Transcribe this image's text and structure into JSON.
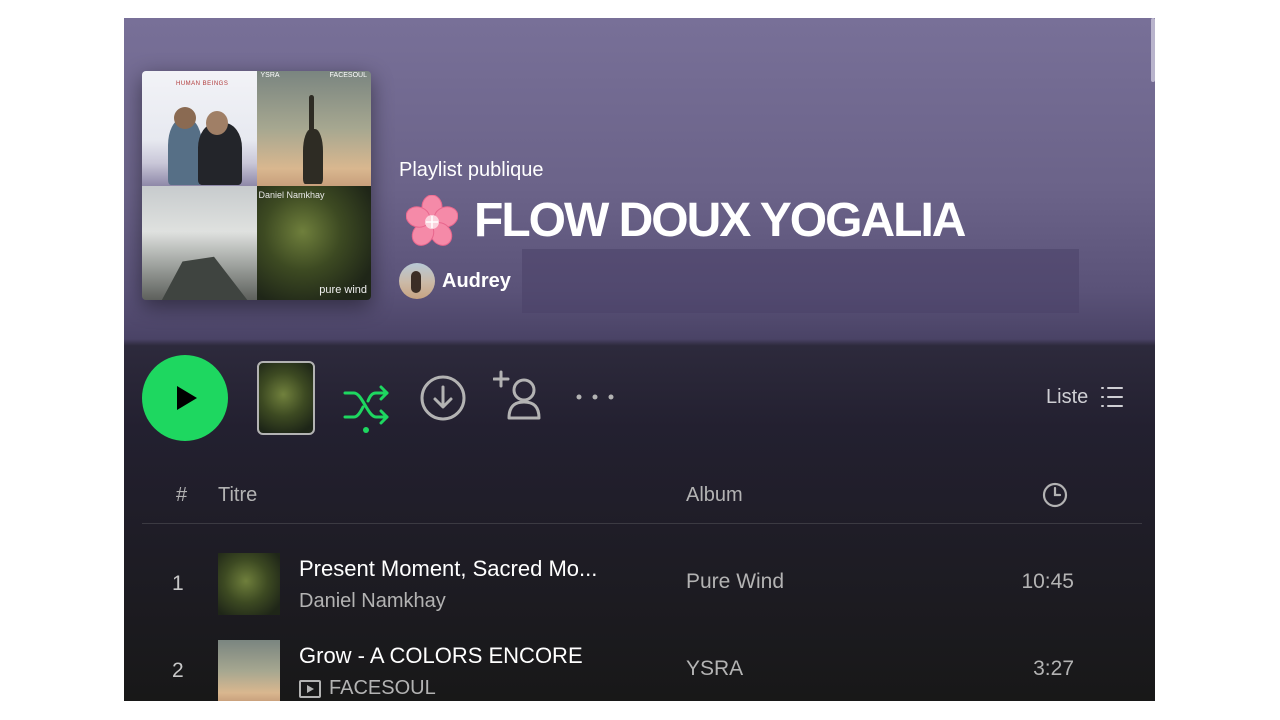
{
  "playlist": {
    "type_label": "Playlist publique",
    "title": "FLOW DOUX YOGALIA",
    "owner": "Audrey",
    "cover_texts": {
      "top_left": "HUMAN BEINGS",
      "top_middle": "YSRA",
      "top_right": "FACESOUL",
      "bottom_right_top": "Daniel Namkhay",
      "bottom_right": "pure wind"
    }
  },
  "actions": {
    "view_label": "Liste",
    "icons": [
      "play-icon",
      "shuffle-icon",
      "download-icon",
      "add-user-icon",
      "more-icon",
      "list-icon"
    ],
    "accent_color": "#1ed760"
  },
  "table": {
    "headers": {
      "number": "#",
      "title": "Titre",
      "album": "Album",
      "duration_icon": "clock-icon"
    },
    "rows": [
      {
        "number": "1",
        "title": "Present Moment, Sacred Mo...",
        "artist": "Daniel Namkhay",
        "album": "Pure Wind",
        "duration": "10:45",
        "video": false
      },
      {
        "number": "2",
        "title": "Grow - A COLORS ENCORE",
        "artist": "FACESOUL",
        "album": "YSRA",
        "duration": "3:27",
        "video": true
      }
    ]
  }
}
